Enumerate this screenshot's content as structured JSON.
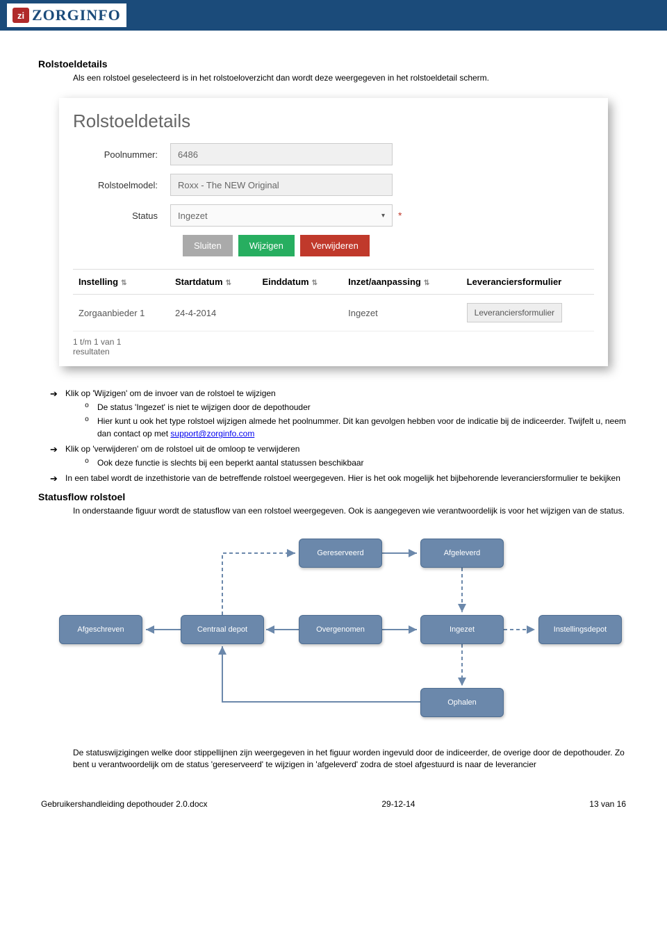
{
  "header": {
    "logo_abbrev": "zi",
    "logo_text": "ZORGINFO"
  },
  "section1": {
    "title": "Rolstoeldetails",
    "intro": "Als een rolstoel geselecteerd is in het rolstoeloverzicht dan wordt deze weergegeven in het rolstoeldetail scherm."
  },
  "screenshot": {
    "title": "Rolstoeldetails",
    "poolnummer_label": "Poolnummer:",
    "poolnummer_value": "6486",
    "rolstoelmodel_label": "Rolstoelmodel:",
    "rolstoelmodel_value": "Roxx - The NEW Original",
    "status_label": "Status",
    "status_value": "Ingezet",
    "buttons": {
      "sluiten": "Sluiten",
      "wijzigen": "Wijzigen",
      "verwijderen": "Verwijderen"
    },
    "table": {
      "headers": [
        "Instelling",
        "Startdatum",
        "Einddatum",
        "Inzet/aanpassing",
        "Leveranciersformulier"
      ],
      "row": {
        "instelling": "Zorgaanbieder 1",
        "startdatum": "24-4-2014",
        "einddatum": "",
        "inzet": "Ingezet",
        "lever_btn": "Leveranciersformulier"
      }
    },
    "resultcount": "1 t/m 1 van 1\nresultaten"
  },
  "bullets": {
    "b1": "Klik op 'Wijzigen' om de invoer van de rolstoel te wijzigen",
    "b1_sub1": "De status 'Ingezet' is niet te wijzigen door de depothouder",
    "b1_sub2a": "Hier kunt u ook het type rolstoel wijzigen almede het poolnummer. Dit kan gevolgen hebben voor de indicatie bij de indiceerder. Twijfelt u, neem dan contact op met ",
    "b1_sub2_link": "support@zorginfo.com",
    "b2": "Klik op 'verwijderen' om de rolstoel uit de omloop te verwijderen",
    "b2_sub1": "Ook deze functie is slechts bij een beperkt aantal statussen beschikbaar",
    "b3": "In een tabel wordt de inzethistorie van de betreffende rolstoel weergegeven. Hier is het ook mogelijk het bijbehorende leveranciersformulier te bekijken"
  },
  "section2": {
    "title": "Statusflow rolstoel",
    "intro": "In onderstaande figuur wordt de statusflow van een rolstoel weergegeven. Ook is aangegeven wie verantwoordelijk is voor het wijzigen van de status.",
    "outro": "De statuswijzigingen welke door stippellijnen zijn weergegeven in het figuur worden ingevuld door de indiceerder, de overige door de depothouder. Zo bent u verantwoordelijk om de status 'gereserveerd' te wijzigen in 'afgeleverd' zodra de stoel afgestuurd is naar de leverancier"
  },
  "flow": {
    "gereserveerd": "Gereserveerd",
    "afgeleverd": "Afgeleverd",
    "afgeschreven": "Afgeschreven",
    "centraal": "Centraal depot",
    "overgenomen": "Overgenomen",
    "ingezet": "Ingezet",
    "instellingsdepot": "Instellingsdepot",
    "ophalen": "Ophalen"
  },
  "footer": {
    "left": "Gebruikershandleiding depothouder 2.0.docx",
    "center": "29-12-14",
    "right": "13 van 16"
  }
}
